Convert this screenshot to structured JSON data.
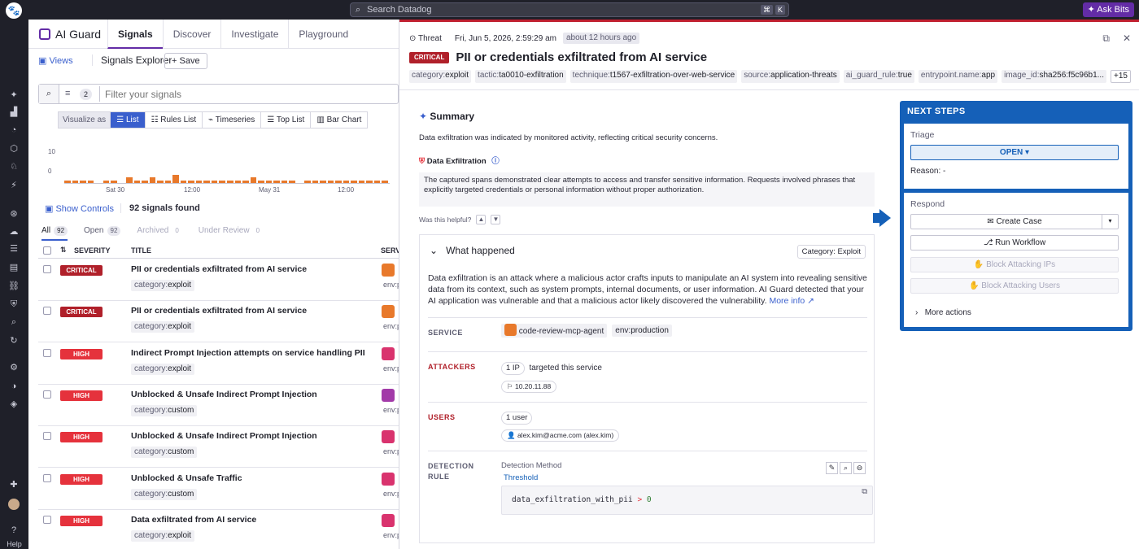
{
  "topbar": {
    "search_placeholder": "Search Datadog",
    "shortcut_keys": [
      "⌘",
      "K"
    ],
    "ask_bits": "Ask Bits"
  },
  "nav": {
    "help": "Help"
  },
  "product": {
    "name": "AI Guard",
    "tabs": [
      "Signals",
      "Discover",
      "Investigate",
      "Playground"
    ],
    "active_tab": "Signals"
  },
  "explorer": {
    "views_label": "Views",
    "title": "Signals Explorer",
    "save_label": "Save",
    "filter_count": "2",
    "filter_placeholder": "Filter your signals",
    "visualize_label": "Visualize as",
    "viz_options": [
      "List",
      "Rules List",
      "Timeseries",
      "Top List",
      "Bar Chart"
    ],
    "show_controls": "Show Controls",
    "found": "92 signals found",
    "status_tabs": [
      {
        "label": "All",
        "count": "92"
      },
      {
        "label": "Open",
        "count": "92"
      },
      {
        "label": "Archived",
        "count": "0"
      },
      {
        "label": "Under Review",
        "count": "0"
      }
    ],
    "columns": [
      "SEVERITY",
      "TITLE",
      "SERVI"
    ]
  },
  "chart_data": {
    "type": "bar",
    "y_ticks": [
      "10",
      "0"
    ],
    "x_ticks": [
      "Sat 30",
      "12:00",
      "May 31",
      "12:00"
    ],
    "values": [
      1,
      1,
      1,
      1,
      0,
      1,
      1,
      0,
      2,
      1,
      1,
      2,
      1,
      1,
      3,
      1,
      1,
      1,
      1,
      1,
      1,
      1,
      1,
      1,
      2,
      1,
      1,
      1,
      1,
      1,
      0,
      1,
      1,
      1,
      1,
      1,
      1,
      1,
      1,
      1,
      1,
      1
    ],
    "ylim": [
      0,
      12
    ],
    "color": "#e8792b"
  },
  "signals": [
    {
      "severity": "CRITICAL",
      "title": "PII or credentials exfiltrated from AI service",
      "tag_key": "category:",
      "tag_val": "exploit",
      "svc_color": "#e8792b",
      "env": "env:p"
    },
    {
      "severity": "CRITICAL",
      "title": "PII or credentials exfiltrated from AI service",
      "tag_key": "category:",
      "tag_val": "exploit",
      "svc_color": "#e8792b",
      "env": "env:p"
    },
    {
      "severity": "HIGH",
      "title": "Indirect Prompt Injection attempts on service handling PII",
      "tag_key": "category:",
      "tag_val": "exploit",
      "svc_color": "#d9336e",
      "env": "env:p"
    },
    {
      "severity": "HIGH",
      "title": "Unblocked & Unsafe Indirect Prompt Injection",
      "tag_key": "category:",
      "tag_val": "custom",
      "svc_color": "#a23aa8",
      "env": "env:p"
    },
    {
      "severity": "HIGH",
      "title": "Unblocked & Unsafe Indirect Prompt Injection",
      "tag_key": "category:",
      "tag_val": "custom",
      "svc_color": "#d9336e",
      "env": "env:p"
    },
    {
      "severity": "HIGH",
      "title": "Unblocked & Unsafe Traffic",
      "tag_key": "category:",
      "tag_val": "custom",
      "svc_color": "#d9336e",
      "env": "env:p"
    },
    {
      "severity": "HIGH",
      "title": "Data exfiltrated from AI service",
      "tag_key": "category:",
      "tag_val": "exploit",
      "svc_color": "#d9336e",
      "env": "env:p"
    }
  ],
  "panel": {
    "type": "Threat",
    "timestamp": "Fri, Jun 5, 2026, 2:59:29 am",
    "ago": "about 12 hours ago",
    "severity": "CRITICAL",
    "title": "PII or credentials exfiltrated from AI service",
    "tags": [
      {
        "k": "category:",
        "v": "exploit"
      },
      {
        "k": "tactic:",
        "v": "ta0010-exfiltration"
      },
      {
        "k": "technique:",
        "v": "t1567-exfiltration-over-web-service"
      },
      {
        "k": "source:",
        "v": "application-threats"
      },
      {
        "k": "ai_guard_rule:",
        "v": "true"
      },
      {
        "k": "entrypoint.name:",
        "v": "app"
      },
      {
        "k": "image_id:",
        "v": "sha256:f5c96b1..."
      }
    ],
    "more_tags": "+15",
    "summary_title": "Summary",
    "summary_text": "Data exfiltration was indicated by monitored activity, reflecting critical security concerns.",
    "dex_title": "Data Exfiltration",
    "dex_text": "The captured spans demonstrated clear attempts to access and transfer sensitive information. Requests involved phrases that explicitly targeted credentials or personal information without proper authorization.",
    "helpful": "Was this helpful?",
    "what_title": "What happened",
    "what_category": "Category: Exploit",
    "what_text": "Data exfiltration is an attack where a malicious actor crafts inputs to manipulate an AI system into revealing sensitive data from its context, such as system prompts, internal documents, or user information. AI Guard detected that your AI application was vulnerable and that a malicious actor likely discovered the vulnerability.",
    "more_info": "More info",
    "service_label": "SERVICE",
    "service_name": "code-review-mcp-agent",
    "service_env_k": "env:",
    "service_env_v": "production",
    "attackers_label": "ATTACKERS",
    "attackers_count": "1 IP",
    "attackers_text": "targeted this service",
    "attacker_ip": "10.20.11.88",
    "users_label": "USERS",
    "users_count": "1 user",
    "user_email": "alex.kim@acme.com (alex.kim)",
    "detection_label_1": "DETECTION",
    "detection_label_2": "RULE",
    "detection_method": "Detection Method",
    "threshold": "Threshold",
    "code_var": "data_exfiltration_with_pii",
    "code_op": ">",
    "code_num": "0"
  },
  "next_steps": {
    "title": "NEXT STEPS",
    "triage": "Triage",
    "open": "OPEN",
    "reason": "Reason: -",
    "respond": "Respond",
    "create_case": "Create Case",
    "run_workflow": "Run Workflow",
    "block_ips": "Block Attacking IPs",
    "block_users": "Block Attacking Users",
    "more_actions": "More actions"
  }
}
